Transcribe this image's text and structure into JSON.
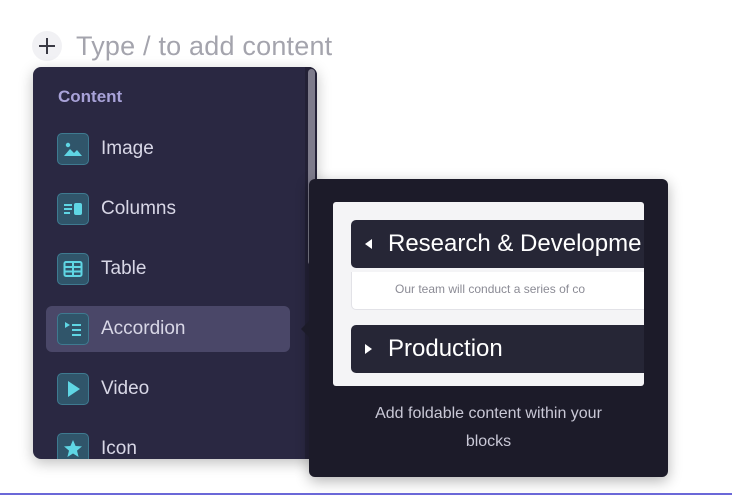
{
  "editor": {
    "add_icon": "plus-icon",
    "placeholder": "Type / to add content"
  },
  "menu": {
    "section_title": "Content",
    "items": [
      {
        "label": "Image",
        "icon": "image-icon"
      },
      {
        "label": "Columns",
        "icon": "columns-icon"
      },
      {
        "label": "Table",
        "icon": "table-icon"
      },
      {
        "label": "Accordion",
        "icon": "accordion-icon",
        "selected": true
      },
      {
        "label": "Video",
        "icon": "video-icon"
      },
      {
        "label": "Icon",
        "icon": "star-icon"
      }
    ]
  },
  "preview": {
    "accordion": [
      {
        "title": "Research & Developme",
        "expanded": true,
        "body": "Our team will conduct a series of co"
      },
      {
        "title": "Production",
        "expanded": false
      }
    ],
    "description_line1": "Add foldable content within your",
    "description_line2": "blocks"
  },
  "colors": {
    "menu_bg": "#2a2842",
    "accent": "#a8a2d8",
    "icon_accent": "#5fd6e4",
    "preview_bg": "#1c1b29"
  }
}
